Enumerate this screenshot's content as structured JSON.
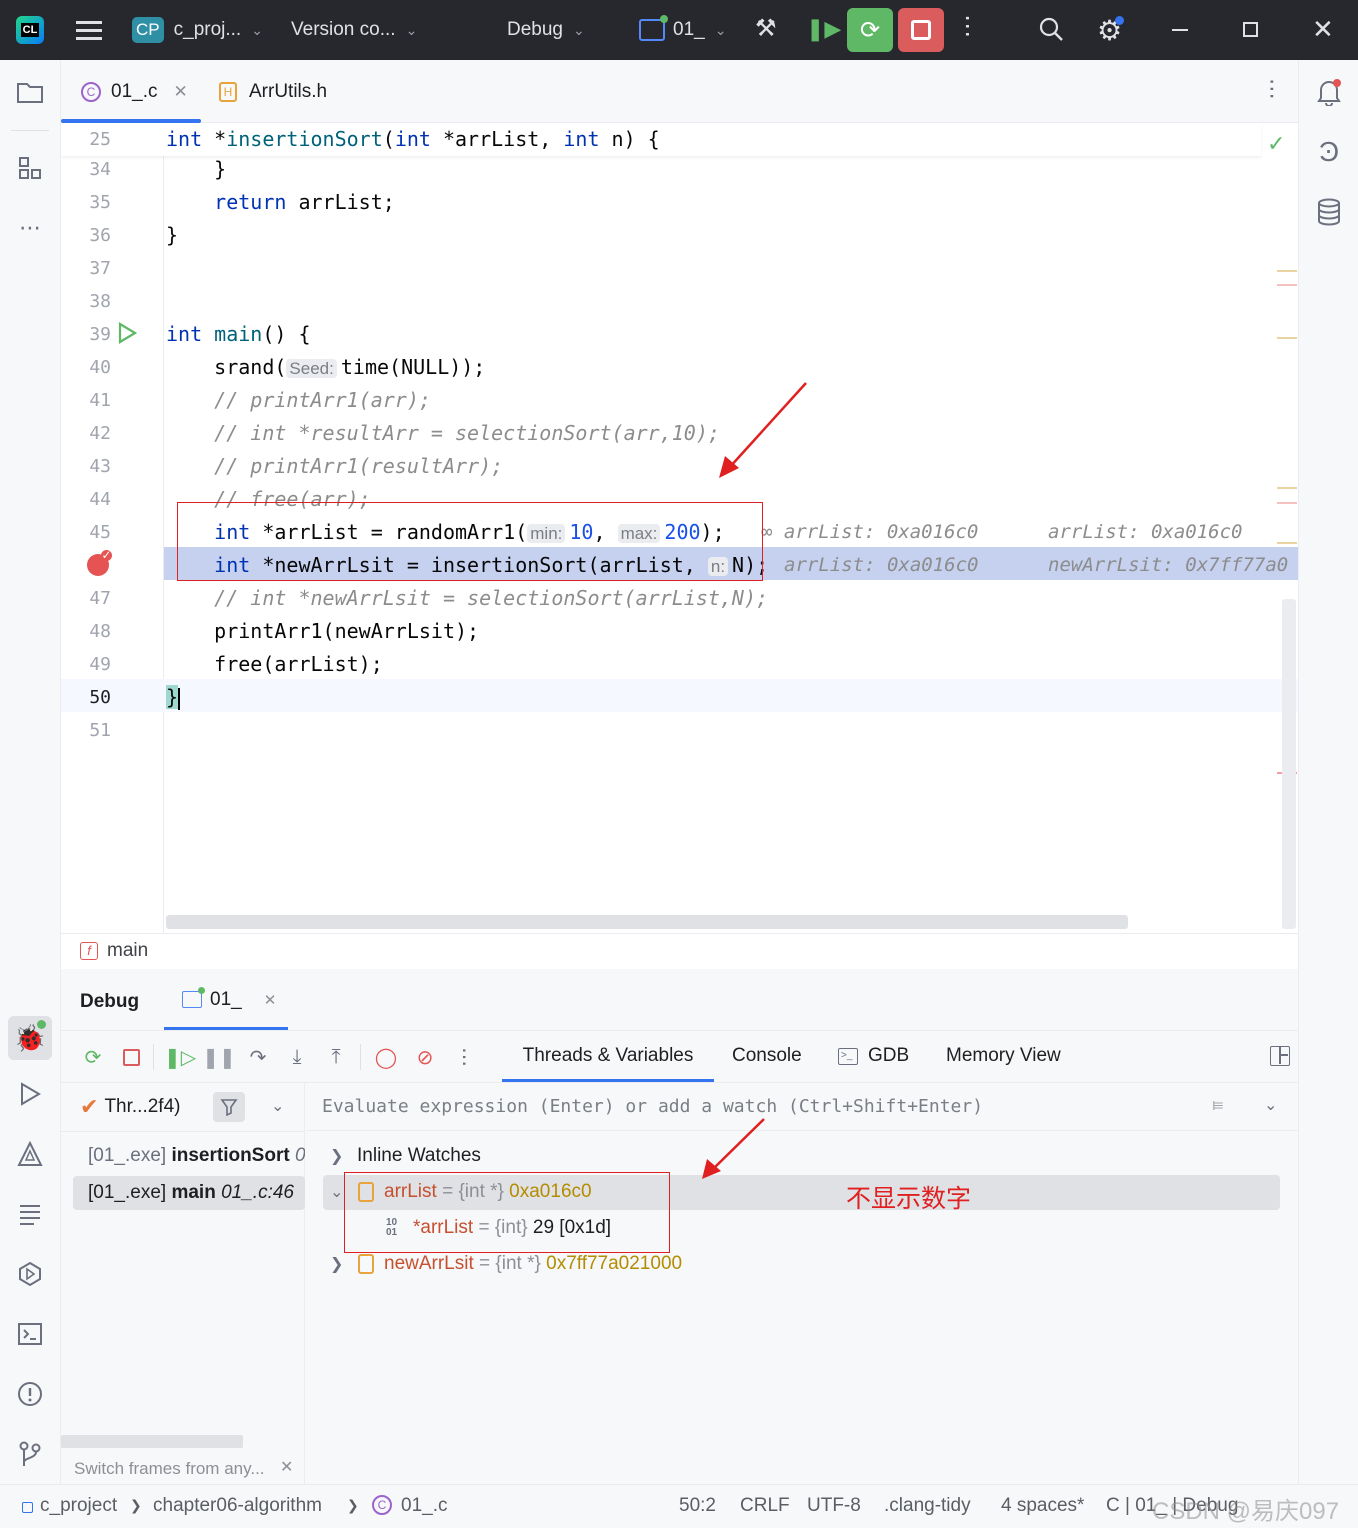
{
  "titlebar": {
    "project_badge": "CP",
    "project_name": "c_proj...",
    "vcs": "Version co...",
    "config": "Debug",
    "run_target": "01_"
  },
  "tabs": [
    {
      "label": "01_.c",
      "active": true
    },
    {
      "label": "ArrUtils.h",
      "active": false
    }
  ],
  "editor": {
    "sticky_line": {
      "num": "25",
      "text": "int *insertionSort(int *arrList, int n) {"
    },
    "lines": [
      {
        "num": "34"
      },
      {
        "num": "35"
      },
      {
        "num": "36"
      },
      {
        "num": "37"
      },
      {
        "num": "38"
      },
      {
        "num": "39"
      },
      {
        "num": "40"
      },
      {
        "num": "41"
      },
      {
        "num": "42"
      },
      {
        "num": "43"
      },
      {
        "num": "44"
      },
      {
        "num": "45"
      },
      {
        "num": "46"
      },
      {
        "num": "47"
      },
      {
        "num": "48"
      },
      {
        "num": "49"
      },
      {
        "num": "50"
      },
      {
        "num": "51"
      }
    ],
    "code": {
      "l34": "}",
      "l35_kw": "return",
      "l35_rest": " arrList;",
      "l36": "}",
      "l39_kw": "int",
      "l39_fn": "main",
      "l39_rest": "() {",
      "l40_a": "srand(",
      "l40_hint": "Seed:",
      "l40_b": "time(NULL));",
      "l41": "// printArr1(arr);",
      "l42": "// int *resultArr = selectionSort(arr,10);",
      "l43": "// printArr1(resultArr);",
      "l44": "// free(arr);",
      "l45_kw": "int",
      "l45_a": " *arrList = randomArr1(",
      "l45_h1": "min:",
      "l45_n1": "10",
      "l45_c": ", ",
      "l45_h2": "max:",
      "l45_n2": "200",
      "l45_d": ");",
      "l46_kw": "int",
      "l46_a": " *newArrLsit = insertionSort(arrList, ",
      "l46_h": "n:",
      "l46_b": "N);",
      "l47": "// int *newArrLsit = selectionSort(arrList,N);",
      "l48": "printArr1(newArrLsit);",
      "l49": "free(arrList);",
      "l50": "}"
    },
    "inline_values": {
      "l45_a": "arrList: 0xa016c0",
      "l45_b": "arrList: 0xa016c0",
      "l46_a": "arrList: 0xa016c0",
      "l46_b": "newArrLsit: 0x7ff77a0"
    }
  },
  "breadcrumb": {
    "function": "main"
  },
  "debug": {
    "title": "Debug",
    "session_tab": "01_",
    "tabs": [
      "Threads & Variables",
      "Console",
      "GDB",
      "Memory View"
    ],
    "thread": "Thr...2f4)",
    "frames": [
      {
        "module": "[01_.exe]",
        "func": "insertionSort",
        "loc": "0"
      },
      {
        "module": "[01_.exe]",
        "func": "main",
        "loc": "01_.c:46"
      }
    ],
    "frames_hint": "Switch frames from any...",
    "eval_placeholder": "Evaluate expression (Enter) or add a watch (Ctrl+Shift+Enter)",
    "inline_watches": "Inline Watches",
    "vars": [
      {
        "name": "arrList",
        "type": " = {int *} ",
        "value": "0xa016c0"
      },
      {
        "name": "*arrList",
        "type": " = {int} ",
        "value": "29 [0x1d]"
      },
      {
        "name": "newArrLsit",
        "type": " = {int *} ",
        "value": "0x7ff77a021000"
      }
    ],
    "annotation": "不显示数字"
  },
  "statusbar": {
    "crumbs": [
      "c_project",
      "chapter06-algorithm",
      "01_.c"
    ],
    "position": "50:2",
    "line_sep": "CRLF",
    "encoding": "UTF-8",
    "inspector": ".clang-tidy",
    "indent": "4 spaces*",
    "context": "C | 01_ | Debug",
    "watermark": "CSDN @易庆097"
  },
  "colors": {
    "accent": "#3574f0",
    "run_green": "#5fb865",
    "stop_red": "#db5c5c",
    "annotation_red": "#e02020",
    "exec_line": "#c5d1ef"
  }
}
